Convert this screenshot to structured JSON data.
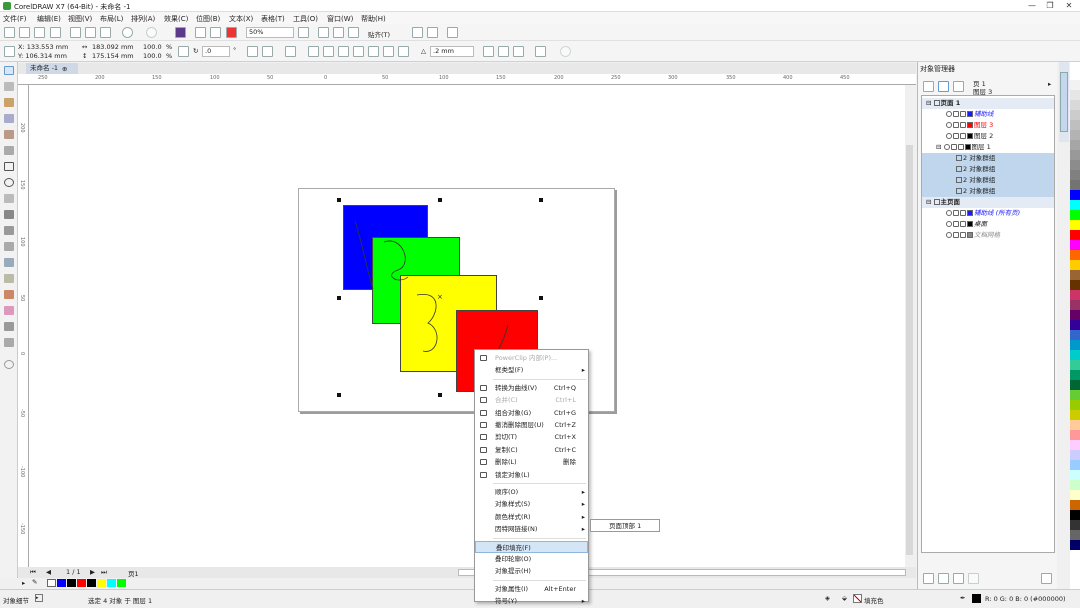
{
  "window": {
    "title": "CorelDRAW X7 (64-Bit) - 未命名 -1",
    "minimize": "—",
    "restore": "❐",
    "close": "✕"
  },
  "menu": [
    "文件(F)",
    "编辑(E)",
    "视图(V)",
    "布局(L)",
    "排列(A)",
    "效果(C)",
    "位图(B)",
    "文本(X)",
    "表格(T)",
    "工具(O)",
    "窗口(W)",
    "帮助(H)"
  ],
  "toolbar": {
    "zoom": "50%",
    "snap": "贴齐(T)"
  },
  "propbar": {
    "x": "X: 133.553 mm",
    "y": "Y: 106.314 mm",
    "w": "183.092 mm",
    "h": "175.154 mm",
    "sx": "100.0",
    "sy": "100.0",
    "pct": "%",
    "angle": ".0",
    "deg": "°",
    "outline": ".2 mm"
  },
  "doc_tab": "未命名 -1",
  "ruler_h": [
    "250",
    "200",
    "150",
    "100",
    "50",
    "0",
    "50",
    "100",
    "150",
    "200",
    "250",
    "300",
    "350",
    "400",
    "450"
  ],
  "ruler_v": [
    "200",
    "150",
    "100",
    "50",
    "0",
    "-50",
    "-100",
    "-150"
  ],
  "page_nav": {
    "first": "⏮",
    "prev": "◀",
    "pages": "1 / 1",
    "next": "▶",
    "last": "⏭",
    "tab": "页1"
  },
  "shapes": [
    {
      "name": "blue-square",
      "color": "#0000FF"
    },
    {
      "name": "green-square",
      "color": "#00FF00"
    },
    {
      "name": "yellow-square",
      "color": "#FFFF00"
    },
    {
      "name": "red-square",
      "color": "#FF0000"
    }
  ],
  "context_menu": {
    "items": [
      {
        "label": "PowerClip 内部(P)...",
        "shortcut": "",
        "disabled": true,
        "submenu": false,
        "icon": true
      },
      {
        "label": "框类型(F)",
        "shortcut": "",
        "disabled": false,
        "submenu": true,
        "icon": false
      },
      {
        "sep": true
      },
      {
        "label": "转换为曲线(V)",
        "shortcut": "Ctrl+Q",
        "disabled": false,
        "submenu": false,
        "icon": true
      },
      {
        "label": "合并(C)",
        "shortcut": "Ctrl+L",
        "disabled": true,
        "submenu": false,
        "icon": true
      },
      {
        "label": "组合对象(G)",
        "shortcut": "Ctrl+G",
        "disabled": false,
        "submenu": false,
        "icon": true
      },
      {
        "label": "撤消删除图层(U)",
        "shortcut": "Ctrl+Z",
        "disabled": false,
        "submenu": false,
        "icon": true
      },
      {
        "label": "剪切(T)",
        "shortcut": "Ctrl+X",
        "disabled": false,
        "submenu": false,
        "icon": true
      },
      {
        "label": "复制(C)",
        "shortcut": "Ctrl+C",
        "disabled": false,
        "submenu": false,
        "icon": true
      },
      {
        "label": "删除(L)",
        "shortcut": "删除",
        "disabled": false,
        "submenu": false,
        "icon": true
      },
      {
        "label": "锁定对象(L)",
        "shortcut": "",
        "disabled": false,
        "submenu": false,
        "icon": true
      },
      {
        "sep": true
      },
      {
        "label": "顺序(O)",
        "shortcut": "",
        "disabled": false,
        "submenu": true,
        "icon": false
      },
      {
        "label": "对象样式(S)",
        "shortcut": "",
        "disabled": false,
        "submenu": true,
        "icon": false
      },
      {
        "label": "颜色样式(R)",
        "shortcut": "",
        "disabled": false,
        "submenu": true,
        "icon": false
      },
      {
        "label": "因特网链接(N)",
        "shortcut": "",
        "disabled": false,
        "submenu": true,
        "icon": false
      },
      {
        "sep": true
      },
      {
        "label": "叠印填充(F)",
        "shortcut": "",
        "disabled": false,
        "submenu": false,
        "icon": false,
        "highlight": true
      },
      {
        "label": "叠印轮廓(O)",
        "shortcut": "",
        "disabled": false,
        "submenu": false,
        "icon": false
      },
      {
        "label": "对象提示(H)",
        "shortcut": "",
        "disabled": false,
        "submenu": false,
        "icon": false
      },
      {
        "sep": true
      },
      {
        "label": "对象属性(I)",
        "shortcut": "Alt+Enter",
        "disabled": false,
        "submenu": false,
        "icon": false
      },
      {
        "label": "符号(Y)",
        "shortcut": "",
        "disabled": false,
        "submenu": true,
        "icon": false
      }
    ],
    "submenu_item": "页面顶部 1"
  },
  "docker": {
    "title": "对象管理器",
    "page_label": "页 1",
    "layer_label": "图层 3",
    "tree": [
      {
        "label": "页面 1",
        "indent": 0,
        "type": "page",
        "sel": false
      },
      {
        "label": "辅助线",
        "indent": 2,
        "type": "layer",
        "color": "#1a1aff",
        "italic": true,
        "sel": false
      },
      {
        "label": "图层 3",
        "indent": 2,
        "type": "layer",
        "color": "#ff0000",
        "sel": false
      },
      {
        "label": "图层 2",
        "indent": 2,
        "type": "layer",
        "color": "#000000",
        "sel": false
      },
      {
        "label": "图层 1",
        "indent": 1,
        "type": "layer",
        "color": "#000000",
        "sel": false
      },
      {
        "label": "2 对象群组",
        "indent": 3,
        "type": "group",
        "sel": true
      },
      {
        "label": "2 对象群组",
        "indent": 3,
        "type": "group",
        "sel": true
      },
      {
        "label": "2 对象群组",
        "indent": 3,
        "type": "group",
        "sel": true
      },
      {
        "label": "2 对象群组",
        "indent": 3,
        "type": "group",
        "sel": true
      },
      {
        "label": "主页面",
        "indent": 0,
        "type": "page",
        "sel": false
      },
      {
        "label": "辅助线 (所有页)",
        "indent": 2,
        "type": "layer",
        "color": "#1a1aff",
        "italic": true,
        "sel": false
      },
      {
        "label": "桌面",
        "indent": 2,
        "type": "layer",
        "color": "#000000",
        "italic": true,
        "sel": false
      },
      {
        "label": "文档网格",
        "indent": 2,
        "type": "layer",
        "color": "#888888",
        "italic": true,
        "sel": false
      }
    ]
  },
  "palette": [
    "#ffffff",
    "#f2f2f2",
    "#e6e6e6",
    "#d9d9d9",
    "#cccccc",
    "#bfbfbf",
    "#b3b3b3",
    "#a6a6a6",
    "#999999",
    "#8c8c8c",
    "#808080",
    "#737373",
    "#0000ff",
    "#00ffff",
    "#00ff00",
    "#ffff00",
    "#ff0000",
    "#ff00ff",
    "#ff6600",
    "#ffcc00",
    "#996633",
    "#663300",
    "#cc3366",
    "#993366",
    "#660066",
    "#330099",
    "#3366cc",
    "#0099cc",
    "#00cccc",
    "#33cc99",
    "#009966",
    "#006633",
    "#66cc33",
    "#99cc00",
    "#cccc00",
    "#ffcc99",
    "#ff9999",
    "#ffccff",
    "#ccccff",
    "#99ccff",
    "#ccffff",
    "#ccffcc",
    "#ffffcc",
    "#cc6600",
    "#000000",
    "#333333",
    "#666666",
    "#000066"
  ],
  "bottom_swatches": [
    "#0000ff",
    "#000000",
    "#ff0000",
    "#000000",
    "#ffff00",
    "#00ffff",
    "#00ff00"
  ],
  "status": {
    "left": "对象细节",
    "middle": "选定 4 对象 于 图层 1",
    "fill": "填充色",
    "color_readout": "R: 0 G: 0 B: 0 (#000000)"
  }
}
